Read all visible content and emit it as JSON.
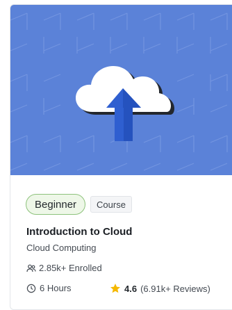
{
  "course": {
    "level": "Beginner",
    "type": "Course",
    "title": "Introduction to Cloud",
    "subtitle": "Cloud Computing",
    "enrolled": "2.85k+ Enrolled",
    "duration": "6 Hours",
    "rating": "4.6",
    "reviews": "(6.91k+ Reviews)"
  },
  "icons": {
    "thumbnail": "cloud-upload-icon",
    "enrolled": "users-icon",
    "duration": "clock-icon",
    "rating": "star-icon"
  },
  "colors": {
    "thumbnail_bg": "#5b82d8",
    "level_border": "#8dc27b",
    "level_bg": "#eef7e8",
    "star": "#f5b800",
    "arrow": "#2f5fd0"
  }
}
